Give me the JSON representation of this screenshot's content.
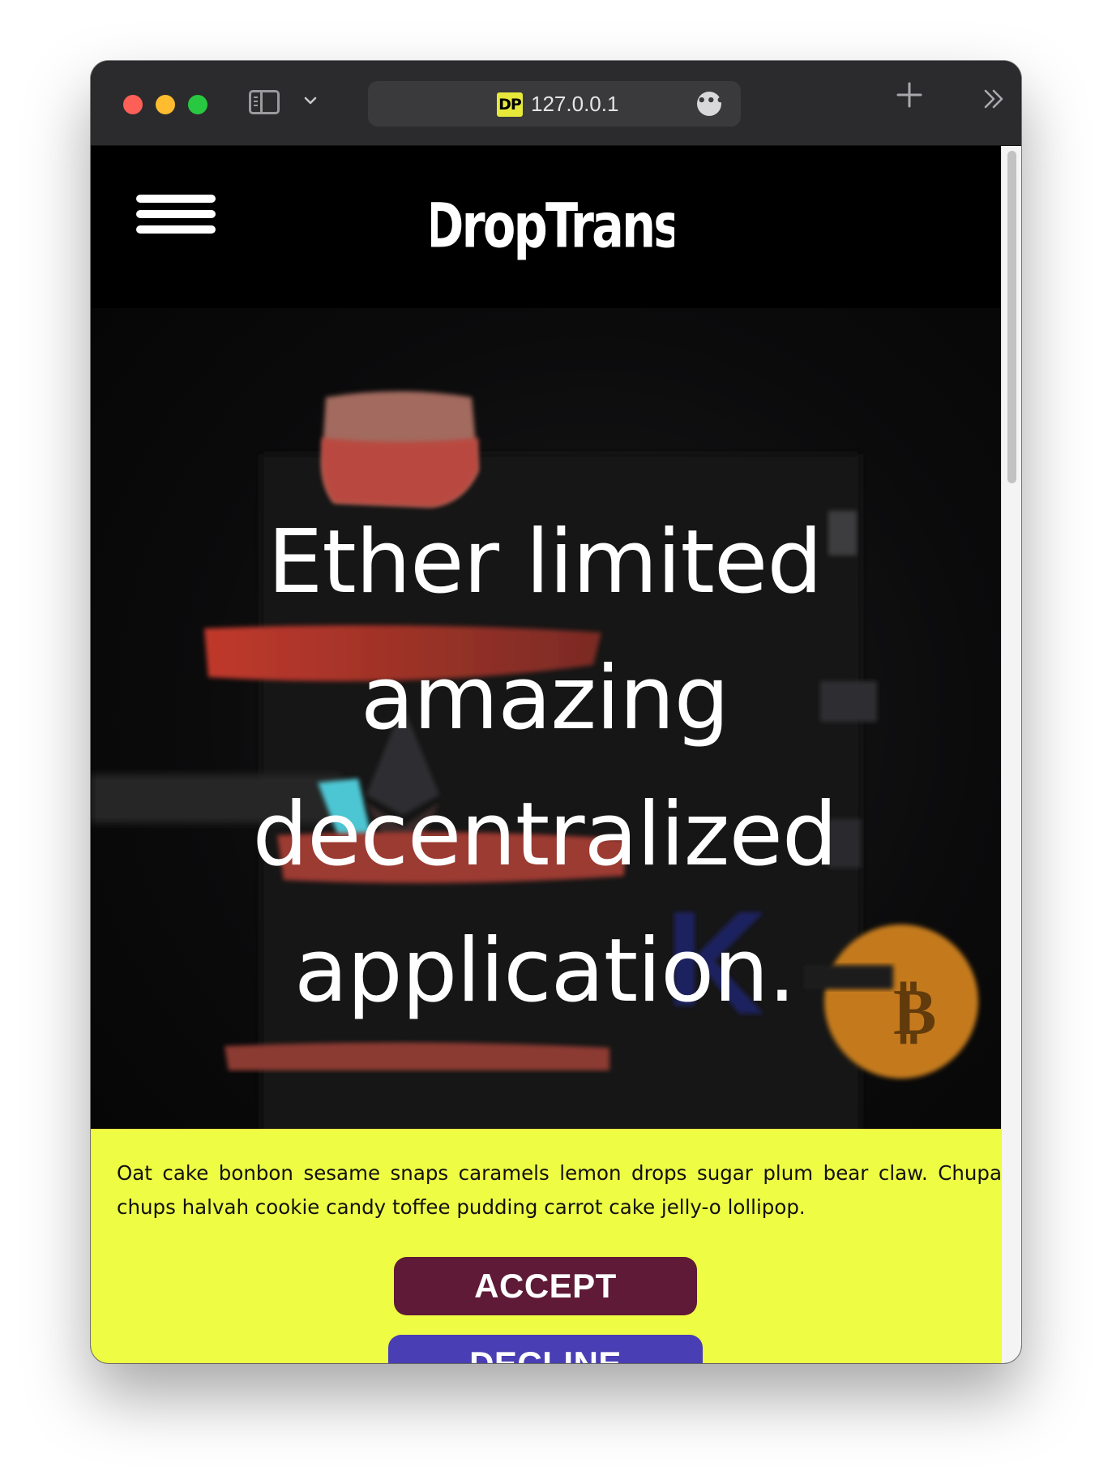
{
  "browser": {
    "url": "127.0.0.1",
    "favicon_text": "DP",
    "favicon_color": "#e6e93a",
    "icons": [
      "sidebar-toggle-icon",
      "chevron-down-icon",
      "more-icon",
      "plus-icon",
      "chevron-double-right-icon"
    ]
  },
  "site": {
    "logo_text": "DropTrans",
    "menu_icon": "hamburger-icon"
  },
  "hero": {
    "title": "Ether limited amazing decentralized application."
  },
  "cookie_banner": {
    "text": "Oat cake bonbon sesame snaps caramels lemon drops sugar plum bear claw. Chupa chups halvah cookie candy toffee pudding carrot cake jelly-o lollipop.",
    "accept_label": "ACCEPT",
    "decline_label": "DECLINE",
    "background_color": "#eefc44",
    "accept_color": "#5e1a36",
    "decline_color": "#4a3eb4"
  }
}
